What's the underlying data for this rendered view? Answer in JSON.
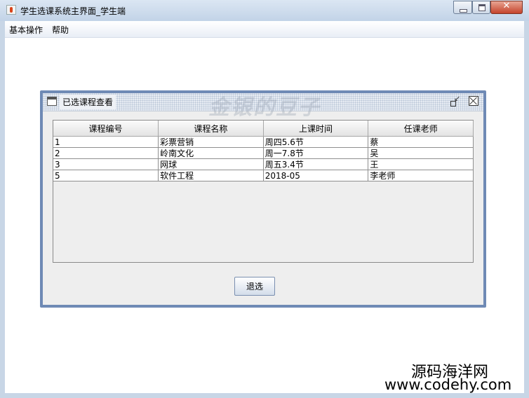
{
  "window": {
    "title": "学生选课系统主界面_学生端",
    "close_glyph": "✕"
  },
  "menubar": {
    "items": [
      {
        "label": "基本操作"
      },
      {
        "label": "帮助"
      }
    ]
  },
  "internal_frame": {
    "title": "已选课程查看",
    "table": {
      "columns": [
        "课程编号",
        "课程名称",
        "上课时间",
        "任课老师"
      ],
      "rows": [
        [
          "1",
          "彩票营销",
          "周四5.6节",
          "蔡"
        ],
        [
          "2",
          "岭南文化",
          "周一7.8节",
          "吴"
        ],
        [
          "3",
          "网球",
          "周五3.4节",
          "王"
        ],
        [
          "5",
          "软件工程",
          "2018-05",
          "李老师"
        ]
      ]
    },
    "drop_button_label": "退选"
  },
  "watermarks": {
    "center": "金银的豆子",
    "corner_cn": "源码海洋网",
    "corner_url": "www.codehy.com"
  },
  "colors": {
    "frame_border": "#6f8ab5",
    "title_bar": "#c8d6e6",
    "close_button": "#c5432b"
  }
}
